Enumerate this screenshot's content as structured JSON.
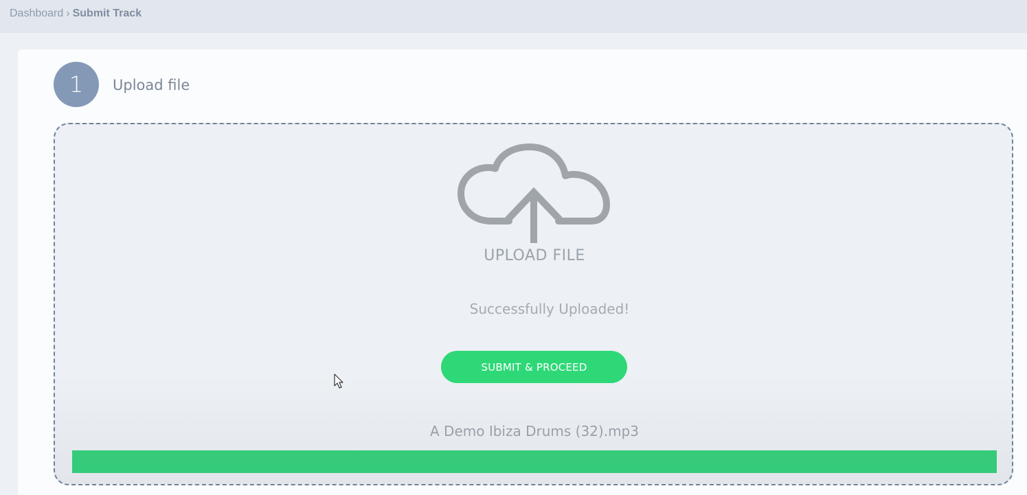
{
  "breadcrumb": {
    "parent": "Dashboard",
    "separator": "›",
    "current": "Submit Track"
  },
  "step": {
    "number": "1",
    "title": "Upload file"
  },
  "dropzone": {
    "icon": "cloud-upload-icon",
    "label": "UPLOAD FILE",
    "status": "Successfully Uploaded!",
    "submit_label": "SUBMIT & PROCEED",
    "file_name": "A Demo Ibiza Drums (32).mp3",
    "progress_percent": 100
  },
  "colors": {
    "accent_green": "#2ed877",
    "progress_green": "#35cb7a",
    "step_circle": "#8499b6"
  }
}
